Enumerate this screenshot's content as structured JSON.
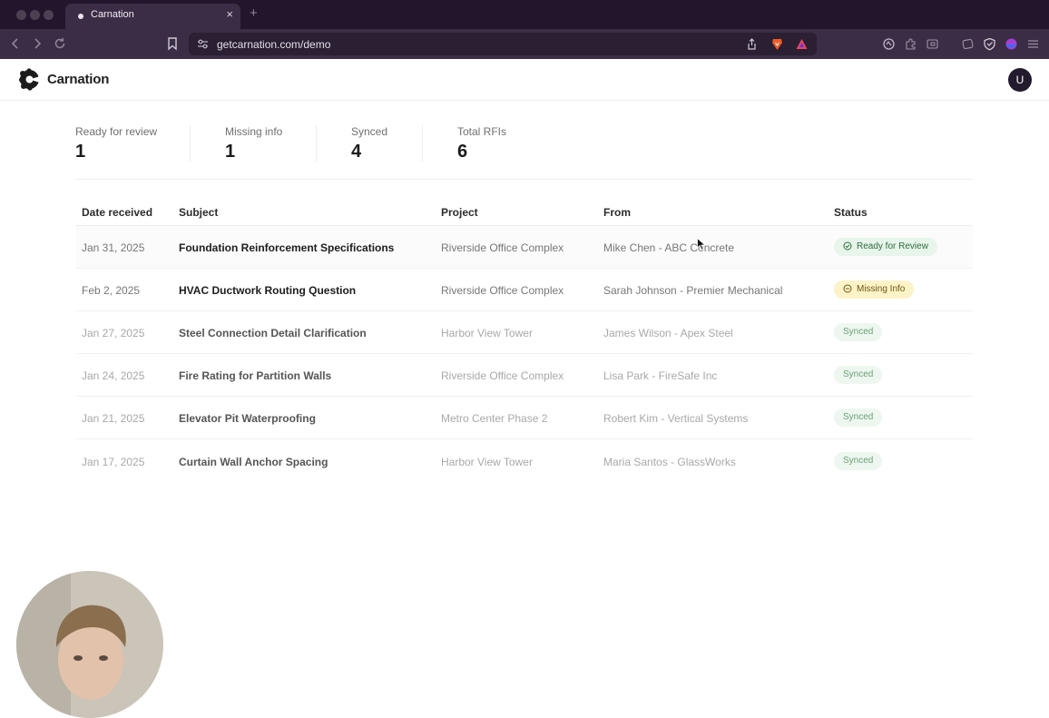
{
  "browser": {
    "tab_title": "Carnation",
    "url": "getcarnation.com/demo",
    "new_tab_symbol": "+",
    "close_symbol": "×"
  },
  "app": {
    "brand": "Carnation",
    "avatar_initial": "U"
  },
  "stats": [
    {
      "label": "Ready for review",
      "value": "1"
    },
    {
      "label": "Missing info",
      "value": "1"
    },
    {
      "label": "Synced",
      "value": "4"
    },
    {
      "label": "Total RFIs",
      "value": "6"
    }
  ],
  "table": {
    "columns": [
      "Date received",
      "Subject",
      "Project",
      "From",
      "Status"
    ],
    "rows": [
      {
        "date": "Jan 31, 2025",
        "subject": "Foundation Reinforcement Specifications",
        "project": "Riverside Office Complex",
        "from": "Mike Chen - ABC Concrete",
        "status": "Ready for Review",
        "status_kind": "ready"
      },
      {
        "date": "Feb 2, 2025",
        "subject": "HVAC Ductwork Routing Question",
        "project": "Riverside Office Complex",
        "from": "Sarah Johnson - Premier Mechanical",
        "status": "Missing Info",
        "status_kind": "missing"
      },
      {
        "date": "Jan 27, 2025",
        "subject": "Steel Connection Detail Clarification",
        "project": "Harbor View Tower",
        "from": "James Wilson - Apex Steel",
        "status": "Synced",
        "status_kind": "synced"
      },
      {
        "date": "Jan 24, 2025",
        "subject": "Fire Rating for Partition Walls",
        "project": "Riverside Office Complex",
        "from": "Lisa Park - FireSafe Inc",
        "status": "Synced",
        "status_kind": "synced"
      },
      {
        "date": "Jan 21, 2025",
        "subject": "Elevator Pit Waterproofing",
        "project": "Metro Center Phase 2",
        "from": "Robert Kim - Vertical Systems",
        "status": "Synced",
        "status_kind": "synced"
      },
      {
        "date": "Jan 17, 2025",
        "subject": "Curtain Wall Anchor Spacing",
        "project": "Harbor View Tower",
        "from": "Maria Santos - GlassWorks",
        "status": "Synced",
        "status_kind": "synced"
      }
    ]
  },
  "colors": {
    "chrome_dark": "#22162c",
    "chrome_toolbar": "#3a2d45",
    "ready_bg": "#e7f5ea",
    "missing_bg": "#fcf3c8",
    "synced_bg": "#edf7ef"
  }
}
